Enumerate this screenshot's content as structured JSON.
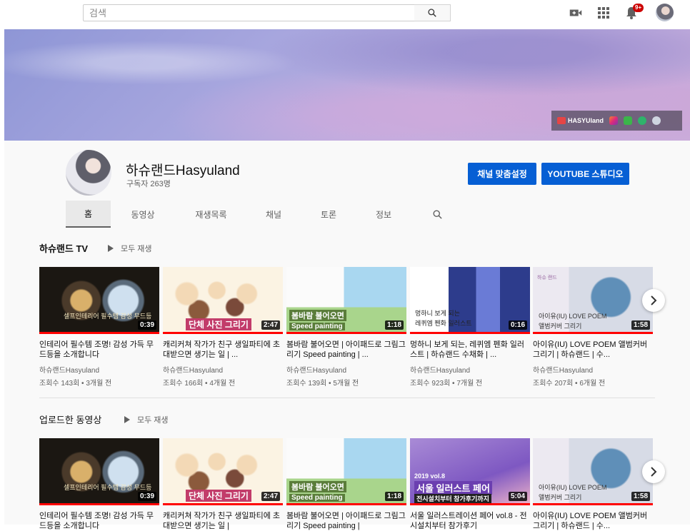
{
  "search": {
    "placeholder": "검색"
  },
  "topbar": {
    "notification_badge": "9+"
  },
  "banner": {
    "brand_label": "HASYUland"
  },
  "channel": {
    "name": "하슈랜드Hasyuland",
    "subscribers": "구독자 263명",
    "customize_button": "채널 맞춤설정",
    "studio_button": "YOUTUBE 스튜디오"
  },
  "tabs": [
    "홈",
    "동영상",
    "재생목록",
    "채널",
    "토론",
    "정보"
  ],
  "sections": [
    {
      "title": "하슈랜드 TV",
      "play_all": "모두 재생",
      "videos": [
        {
          "title": "인테리어 필수템 조명! 감성 가득 무드등을 소개합니다",
          "channel": "하슈랜드Hasyuland",
          "meta": "조회수 143회 • 3개월 전",
          "duration": "0:39",
          "thumb_text": "셀프인테리어 필수템 감성 무드등"
        },
        {
          "title": "캐리커쳐 작가가 친구 생일파티에 초대받으면 생기는 일 | ...",
          "channel": "하슈랜드Hasyuland",
          "meta": "조회수 166회 • 4개월 전",
          "duration": "2:47",
          "thumb_text": "단체 사진 그리기"
        },
        {
          "title": "봄바람 불어오면 | 아이패드로 그림그리기 Speed painting | ...",
          "channel": "하슈랜드Hasyuland",
          "meta": "조회수 139회 • 5개월 전",
          "duration": "1:18",
          "thumb_text": "봄바람 불어오면",
          "thumb_sub": "Speed painting"
        },
        {
          "title": "멍하니 보게 되는, 레퀴엠 펜화 일러스트 | 하슈랜드 수채화 | ...",
          "channel": "하슈랜드Hasyuland",
          "meta": "조회수 923회 • 7개월 전",
          "duration": "0:16",
          "thumb_text": "멍하니 보게 되는",
          "thumb_sub": "레퀴엠 펜화 일러스트"
        },
        {
          "title": "아이유(IU) LOVE POEM 앨범커버 그리기 | 하슈랜드 | 수...",
          "channel": "하슈랜드Hasyuland",
          "meta": "조회수 207회 • 6개월 전",
          "duration": "1:58",
          "thumb_text": "아이유(IU) LOVE POEM",
          "thumb_sub": "앨범커버 그리기",
          "thumb_logo": "하슈\n랜드"
        }
      ]
    },
    {
      "title": "업로드한 동영상",
      "play_all": "모두 재생",
      "videos": [
        {
          "title": "인테리어 필수템 조명! 감성 가득 무드등을 소개합니다",
          "duration": "0:39",
          "thumb_text": "셀프인테리어 필수템 감성 무드등"
        },
        {
          "title": "캐리커쳐 작가가 친구 생일파티에 초대받으면 생기는 일 |",
          "duration": "2:47",
          "thumb_text": "단체 사진 그리기"
        },
        {
          "title": "봄바람 불어오면 | 아이패드로 그림그리기 Speed painting |",
          "duration": "1:18",
          "thumb_text": "봄바람 불어오면",
          "thumb_sub": "Speed painting"
        },
        {
          "title": "서울 일러스트레이션 페어 vol.8 - 전시설치부터 참가후기",
          "duration": "5:04",
          "thumb_text": "서울 일러스트 페어",
          "thumb_sub": "전시설치부터 참가후기까지",
          "thumb_tag": "2019 vol.8"
        },
        {
          "title": "아이유(IU) LOVE POEM 앨범커버 그리기 | 하슈랜드 | 수...",
          "duration": "1:58",
          "thumb_text": "아이유(IU) LOVE POEM",
          "thumb_sub": "앨범커버 그리기"
        }
      ]
    }
  ],
  "colors": {
    "accent_blue": "#065fd4",
    "progress_red": "#ff0000"
  },
  "icons": [
    "search-icon",
    "create-video-icon",
    "apps-grid-icon",
    "notifications-bell-icon",
    "account-avatar",
    "channel-search-icon",
    "chevron-right-icon"
  ]
}
